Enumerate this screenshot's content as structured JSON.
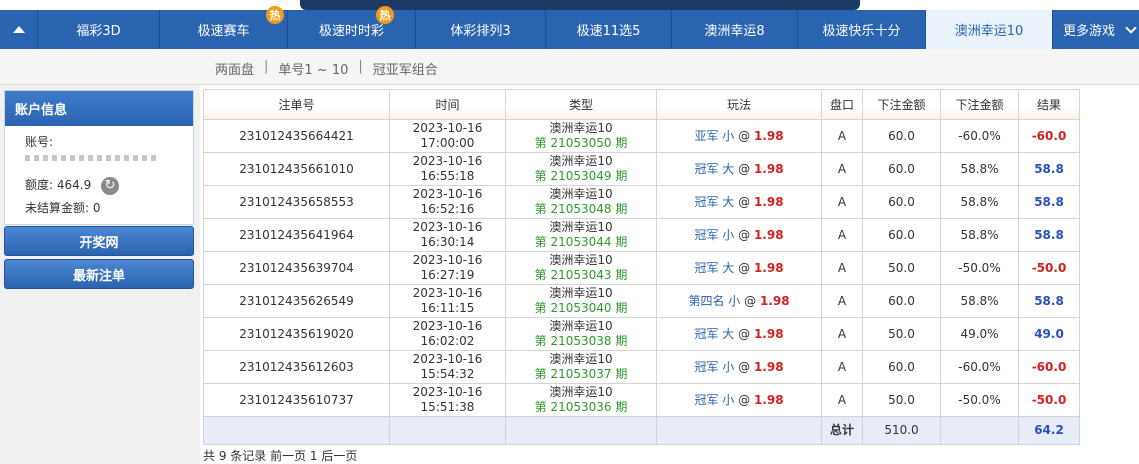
{
  "nav": {
    "tabs": [
      {
        "label": "福彩3D",
        "hot": false,
        "active": false
      },
      {
        "label": "极速赛车",
        "hot": true,
        "active": false
      },
      {
        "label": "极速时时彩",
        "hot": true,
        "active": false
      },
      {
        "label": "体彩排列3",
        "hot": false,
        "active": false
      },
      {
        "label": "极速11选5",
        "hot": false,
        "active": false
      },
      {
        "label": "澳洲幸运8",
        "hot": false,
        "active": false
      },
      {
        "label": "极速快乐十分",
        "hot": false,
        "active": false
      },
      {
        "label": "澳洲幸运10",
        "hot": false,
        "active": true
      },
      {
        "label": "更多游戏",
        "hot": false,
        "active": false
      }
    ],
    "hot_badge": "热"
  },
  "subnav": {
    "items": [
      "两面盘",
      "单号1 ~ 10",
      "冠亚军组合"
    ],
    "separator": "|"
  },
  "sidebar": {
    "account_title": "账户信息",
    "account_label": "账号:",
    "balance_label": "额度:",
    "balance_value": "464.9",
    "unsettled_label": "未结算金额:",
    "unsettled_value": "0",
    "btn_draw": "开奖网",
    "btn_latest": "最新注单"
  },
  "table": {
    "headers": [
      "注单号",
      "时间",
      "类型",
      "玩法",
      "盘口",
      "下注金额",
      "下注金额",
      "结果"
    ],
    "rows": [
      {
        "id": "231012435664421",
        "date": "2023-10-16",
        "time": "17:00:00",
        "type": "澳洲幸运10",
        "issue": "第 21053050 期",
        "play": "亚军 小",
        "at": "@",
        "odds": "1.98",
        "market": "A",
        "amount": "60.0",
        "ratio": "-60.0%",
        "result": "-60.0",
        "result_sign": "neg"
      },
      {
        "id": "231012435661010",
        "date": "2023-10-16",
        "time": "16:55:18",
        "type": "澳洲幸运10",
        "issue": "第 21053049 期",
        "play": "冠军 大",
        "at": "@",
        "odds": "1.98",
        "market": "A",
        "amount": "60.0",
        "ratio": "58.8%",
        "result": "58.8",
        "result_sign": "pos"
      },
      {
        "id": "231012435658553",
        "date": "2023-10-16",
        "time": "16:52:16",
        "type": "澳洲幸运10",
        "issue": "第 21053048 期",
        "play": "冠军 大",
        "at": "@",
        "odds": "1.98",
        "market": "A",
        "amount": "60.0",
        "ratio": "58.8%",
        "result": "58.8",
        "result_sign": "pos"
      },
      {
        "id": "231012435641964",
        "date": "2023-10-16",
        "time": "16:30:14",
        "type": "澳洲幸运10",
        "issue": "第 21053044 期",
        "play": "冠军 小",
        "at": "@",
        "odds": "1.98",
        "market": "A",
        "amount": "60.0",
        "ratio": "58.8%",
        "result": "58.8",
        "result_sign": "pos"
      },
      {
        "id": "231012435639704",
        "date": "2023-10-16",
        "time": "16:27:19",
        "type": "澳洲幸运10",
        "issue": "第 21053043 期",
        "play": "冠军 大",
        "at": "@",
        "odds": "1.98",
        "market": "A",
        "amount": "50.0",
        "ratio": "-50.0%",
        "result": "-50.0",
        "result_sign": "neg"
      },
      {
        "id": "231012435626549",
        "date": "2023-10-16",
        "time": "16:11:15",
        "type": "澳洲幸运10",
        "issue": "第 21053040 期",
        "play": "第四名 小",
        "at": "@",
        "odds": "1.98",
        "market": "A",
        "amount": "60.0",
        "ratio": "58.8%",
        "result": "58.8",
        "result_sign": "pos"
      },
      {
        "id": "231012435619020",
        "date": "2023-10-16",
        "time": "16:02:02",
        "type": "澳洲幸运10",
        "issue": "第 21053038 期",
        "play": "冠军 大",
        "at": "@",
        "odds": "1.98",
        "market": "A",
        "amount": "50.0",
        "ratio": "49.0%",
        "result": "49.0",
        "result_sign": "pos"
      },
      {
        "id": "231012435612603",
        "date": "2023-10-16",
        "time": "15:54:32",
        "type": "澳洲幸运10",
        "issue": "第 21053037 期",
        "play": "冠军 小",
        "at": "@",
        "odds": "1.98",
        "market": "A",
        "amount": "60.0",
        "ratio": "-60.0%",
        "result": "-60.0",
        "result_sign": "neg"
      },
      {
        "id": "231012435610737",
        "date": "2023-10-16",
        "time": "15:51:38",
        "type": "澳洲幸运10",
        "issue": "第 21053036 期",
        "play": "冠军 小",
        "at": "@",
        "odds": "1.98",
        "market": "A",
        "amount": "50.0",
        "ratio": "-50.0%",
        "result": "-50.0",
        "result_sign": "neg"
      }
    ],
    "total_label": "总计",
    "total_amount": "510.0",
    "total_result": "64.2"
  },
  "footer": {
    "text": "共 9 条记录 前一页 1 后一页"
  },
  "colors": {
    "nav_bg": "#2a63b0",
    "issue_green": "#2d9b2d",
    "odds_red": "#d62020",
    "win_blue": "#2a4fc0"
  }
}
